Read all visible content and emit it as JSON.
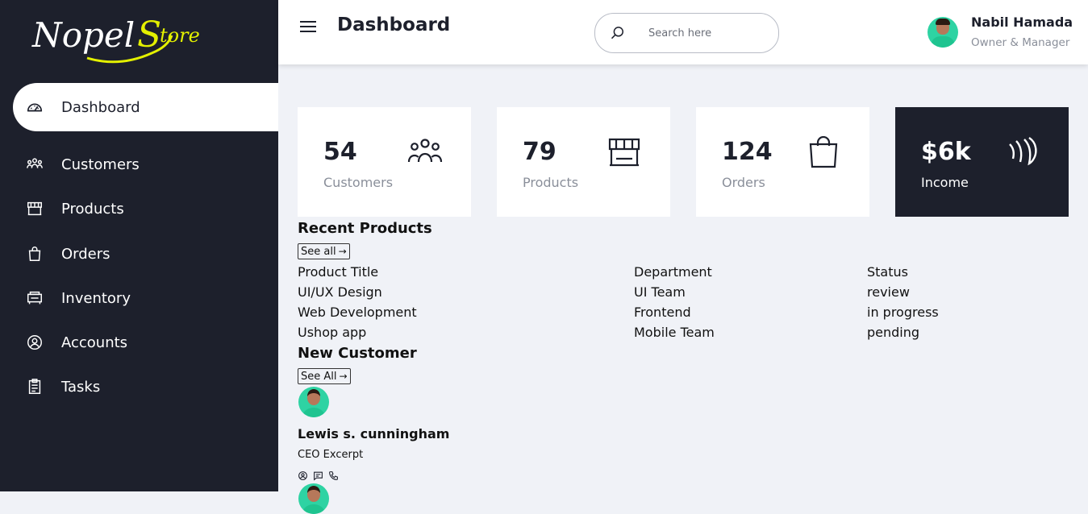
{
  "brand": {
    "logo_text": "NopelStore",
    "accent": "#e3f000"
  },
  "sidebar": {
    "items": [
      {
        "label": "Dashboard",
        "icon": "dashboard-gauge-icon",
        "active": true
      },
      {
        "label": "Customers",
        "icon": "people-group-icon"
      },
      {
        "label": "Products",
        "icon": "storefront-icon"
      },
      {
        "label": "Orders",
        "icon": "shopping-bag-icon"
      },
      {
        "label": "Inventory",
        "icon": "inventory-icon"
      },
      {
        "label": "Accounts",
        "icon": "user-circle-icon"
      },
      {
        "label": "Tasks",
        "icon": "clipboard-list-icon"
      }
    ]
  },
  "header": {
    "title": "Dashboard",
    "search_placeholder": "Search here",
    "user": {
      "name": "Nabil Hamada",
      "role": "Owner & Manager"
    }
  },
  "cards": [
    {
      "value": "54",
      "label": "Customers",
      "icon": "people-group-icon"
    },
    {
      "value": "79",
      "label": "Products",
      "icon": "storefront-icon"
    },
    {
      "value": "124",
      "label": "Orders",
      "icon": "shopping-bag-icon"
    },
    {
      "value": "$6k",
      "label": "Income",
      "icon": "income-waves-icon"
    }
  ],
  "recent_products": {
    "title": "Recent Products",
    "see_all": "See all",
    "columns": [
      "Product Title",
      "Department",
      "Status"
    ],
    "rows": [
      [
        "UI/UX Design",
        "UI Team",
        "review"
      ],
      [
        "Web Development",
        "Frontend",
        "in progress"
      ],
      [
        "Ushop app",
        "Mobile Team",
        "pending"
      ]
    ]
  },
  "new_customer": {
    "title": "New Customer",
    "see_all": "See All",
    "customers": [
      {
        "name": "Lewis s. cunningham",
        "role": "CEO Excerpt"
      }
    ]
  },
  "colors": {
    "sidebar_bg": "#1d202c",
    "page_bg": "#f0f2f7",
    "muted": "#8a8f9a"
  }
}
